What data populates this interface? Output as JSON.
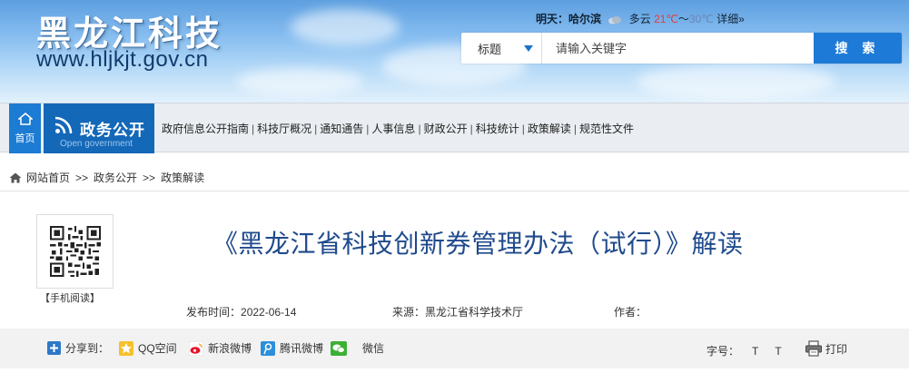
{
  "header": {
    "logo_text": "黑龙江科技",
    "site_url": "www.hljkjt.gov.cn",
    "weather": {
      "day_label": "明天：",
      "city": "哈尔滨",
      "condition": "多云",
      "temp_high": "21℃",
      "separator": "～",
      "temp_low": "30℃",
      "details_link": "详细»"
    },
    "search": {
      "category": "标题",
      "placeholder": "请输入关键字",
      "button_label": "搜 索"
    }
  },
  "nav": {
    "home_label": "首页",
    "section_title": "政务公开",
    "section_subtitle": "Open government",
    "links": [
      "政府信息公开指南",
      "科技厅概况",
      "通知通告",
      "人事信息",
      "财政公开",
      "科技统计",
      "政策解读",
      "规范性文件"
    ],
    "separator": "|"
  },
  "breadcrumb": {
    "items": [
      "网站首页",
      "政务公开",
      "政策解读"
    ],
    "separator": ">>"
  },
  "article": {
    "qr_label": "【手机阅读】",
    "title": "《黑龙江省科技创新券管理办法（试行）》解读",
    "publish_label": "发布时间：",
    "publish_date": "2022-06-14",
    "source_label": "来源：",
    "source_value": "黑龙江省科学技术厅",
    "author_label": "作者：",
    "author_value": ""
  },
  "share": {
    "label": "分享到：",
    "targets": [
      "QQ空间",
      "新浪微博",
      "腾讯微博",
      "微信"
    ],
    "font_size_label": "字号：",
    "font_size_options": [
      "T",
      "T"
    ],
    "print_label": "打印"
  },
  "colors": {
    "brand_blue": "#1468b8",
    "title_blue": "#1f4a8c",
    "search_button": "#1d7ad6",
    "temp_high": "#e53c3c"
  }
}
